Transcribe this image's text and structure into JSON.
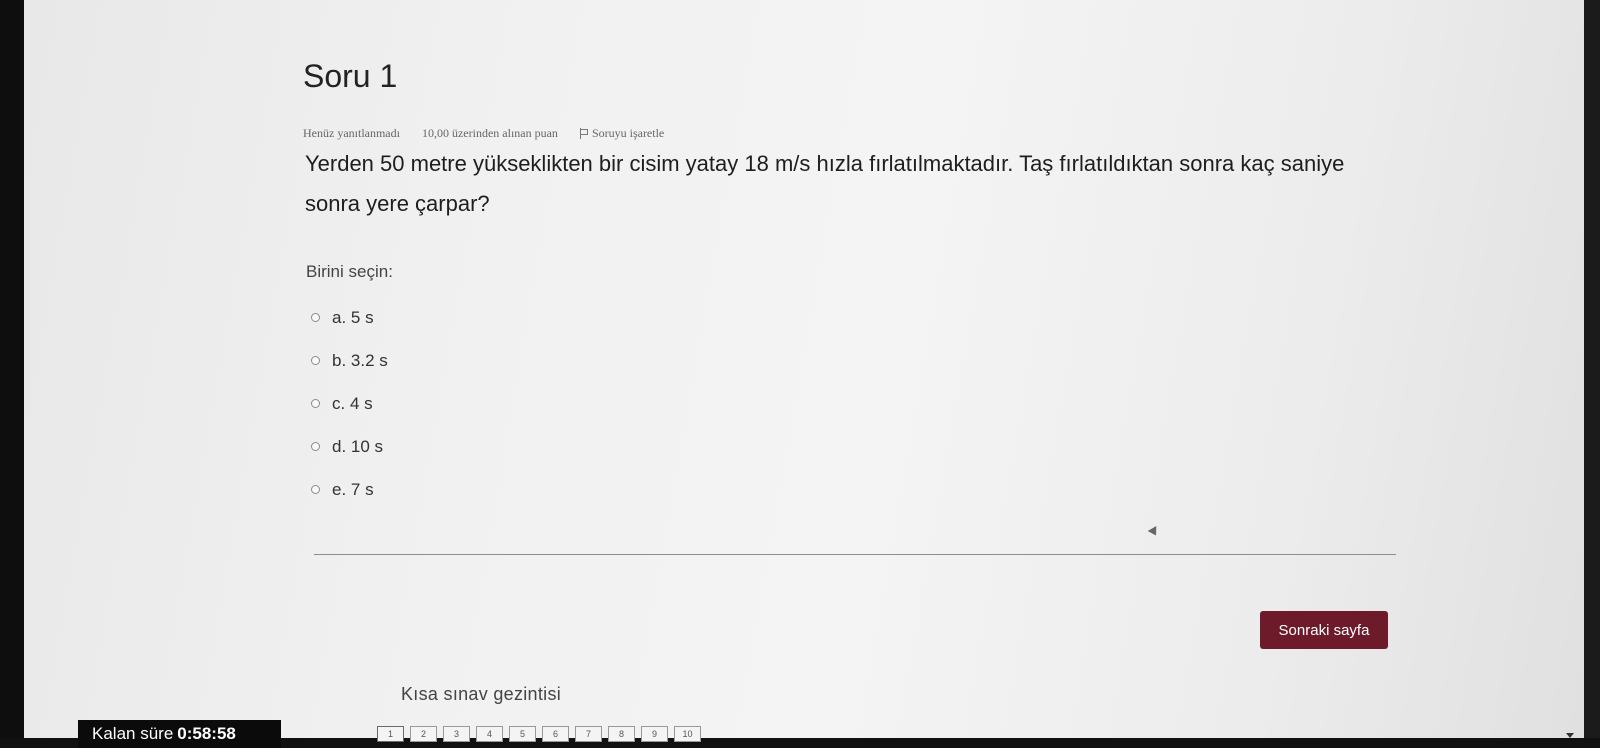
{
  "question": {
    "title": "Soru 1",
    "status": "Henüz yanıtlanmadı",
    "grade": "10,00 üzerinden alınan puan",
    "flag_label": "Soruyu işaretle",
    "text": "Yerden 50 metre yükseklikten bir cisim yatay 18 m/s hızla fırlatılmaktadır. Taş fırlatıldıktan sonra kaç saniye sonra yere çarpar?",
    "prompt": "Birini seçin:",
    "options": [
      {
        "label": "a. 5 s",
        "selected": false
      },
      {
        "label": "b. 3.2 s",
        "selected": false
      },
      {
        "label": "c. 4 s",
        "selected": false
      },
      {
        "label": "d. 10 s",
        "selected": false
      },
      {
        "label": "e. 7 s",
        "selected": false
      }
    ]
  },
  "actions": {
    "next_label": "Sonraki sayfa",
    "next_color": "#6d1a2b"
  },
  "navigation": {
    "title": "Kısa sınav gezintisi",
    "pages": [
      "1",
      "2",
      "3",
      "4",
      "5",
      "6",
      "7",
      "8",
      "9",
      "10"
    ],
    "current_page": "1"
  },
  "timer": {
    "label": "Kalan süre",
    "value": "0:58:58"
  }
}
